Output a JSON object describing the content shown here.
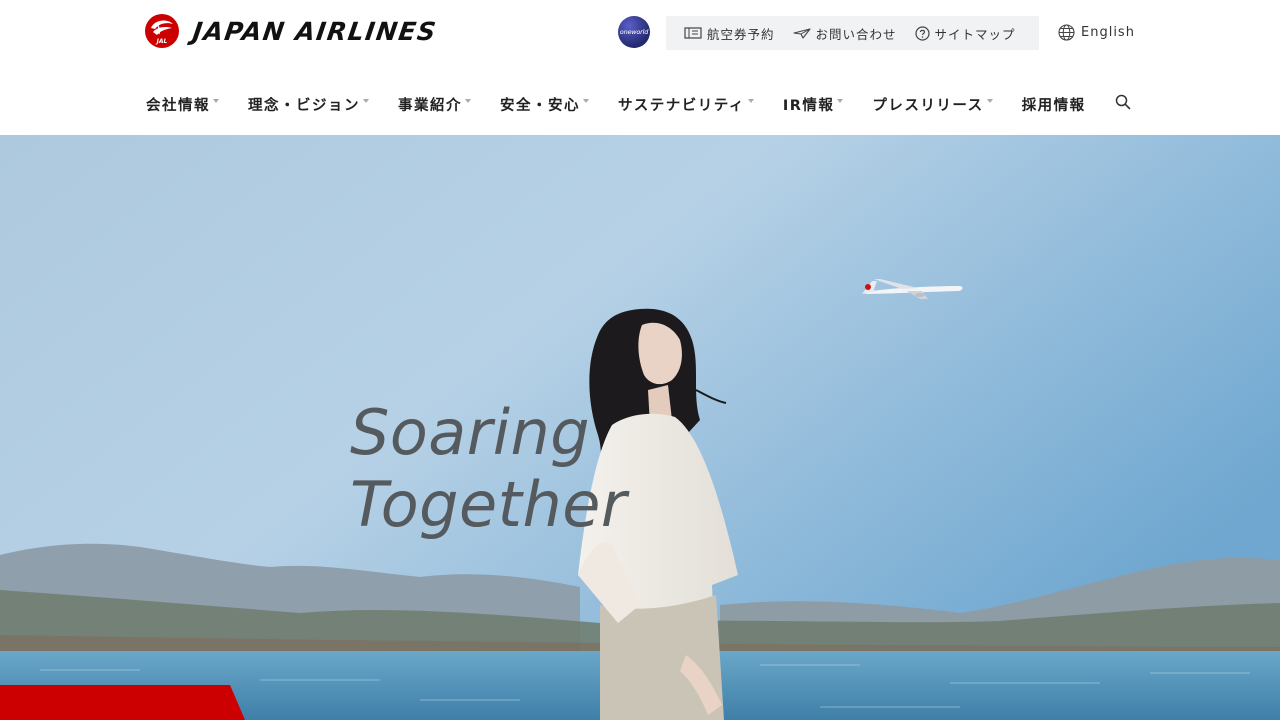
{
  "brand": {
    "name": "JAPAN AIRLINES",
    "logo_icon": "tsurumaru-crane-icon",
    "logo_label": "JAL",
    "brand_red": "#cc0000"
  },
  "alliance": {
    "label": "oneworld"
  },
  "utility": {
    "items": [
      {
        "label": "航空券予約",
        "icon": "ticket-icon"
      },
      {
        "label": "お問い合わせ",
        "icon": "paper-plane-icon"
      },
      {
        "label": "サイトマップ",
        "icon": "question-circle-icon"
      }
    ],
    "language": {
      "label": "English",
      "icon": "globe-icon"
    }
  },
  "nav": {
    "items": [
      {
        "label": "会社情報",
        "has_dropdown": true
      },
      {
        "label": "理念・ビジョン",
        "has_dropdown": true
      },
      {
        "label": "事業紹介",
        "has_dropdown": true
      },
      {
        "label": "安全・安心",
        "has_dropdown": true
      },
      {
        "label": "サステナビリティ",
        "has_dropdown": true
      },
      {
        "label": "IR情報",
        "has_dropdown": true
      },
      {
        "label": "プレスリリース",
        "has_dropdown": true
      },
      {
        "label": "採用情報",
        "has_dropdown": false
      }
    ],
    "search_icon": "search-icon"
  },
  "hero": {
    "tagline_line1": "Soaring",
    "tagline_line2": "Together",
    "sky_color": "#9fc4df",
    "water_color": "#4f8fb5"
  }
}
